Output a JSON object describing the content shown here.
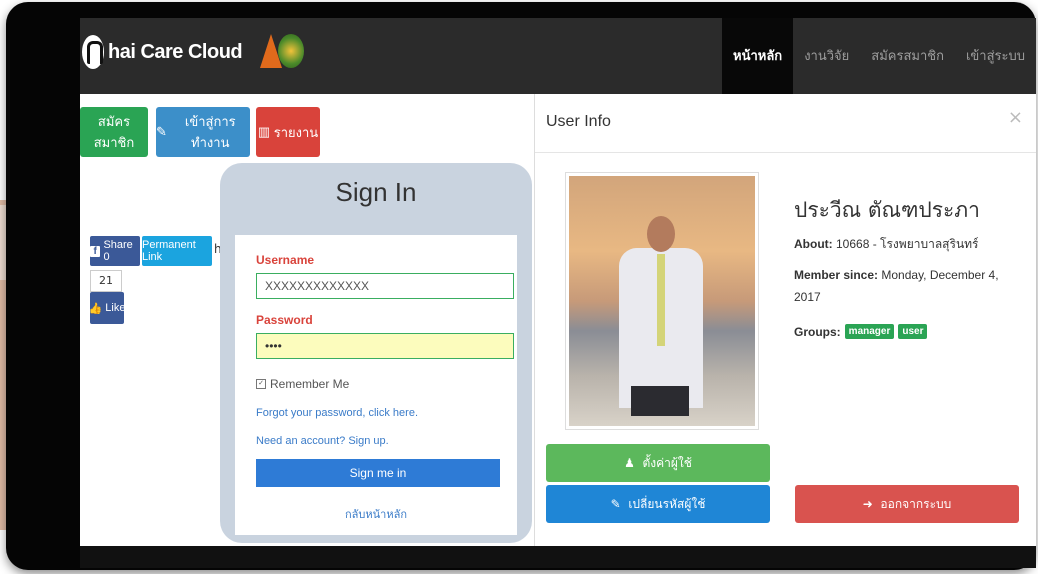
{
  "navbar": {
    "brand": "hai Care Cloud",
    "links": [
      "หน้าหลัก",
      "งานวิจัย",
      "สมัครสมาชิก",
      "เข้าสู่ระบบ"
    ]
  },
  "actions": {
    "register": "สมัครสมาชิก",
    "login": "เข้าสู่การทำงาน",
    "report": "รายงาน"
  },
  "social": {
    "share": "Share 0",
    "permanent_link": "Permanent Link",
    "truncated": "h",
    "like_count": "21",
    "like": "Like"
  },
  "signin": {
    "title": "Sign In",
    "username_label": "Username",
    "username_value": "XXXXXXXXXXXXX",
    "password_label": "Password",
    "password_value": "••••",
    "remember": "Remember Me",
    "forgot": "Forgot your password, click here.",
    "signup": "Need an account? Sign up.",
    "submit": "Sign me in",
    "back_home": "กลับหน้าหลัก"
  },
  "modal": {
    "title": "User Info",
    "close": "×",
    "name": "ประวีณ ตัณฑประภา",
    "about_label": "About:",
    "about_value": "10668 - โรงพยาบาลสุรินทร์",
    "member_label": "Member since:",
    "member_value": "Monday, December 4, 2017",
    "groups_label": "Groups:",
    "groups": [
      "manager",
      "user"
    ],
    "settings_button": "ตั้งค่าผู้ใช้",
    "change_password_button": "เปลี่ยนรหัสผู้ใช้",
    "logout_button": "ออกจากระบบ"
  }
}
